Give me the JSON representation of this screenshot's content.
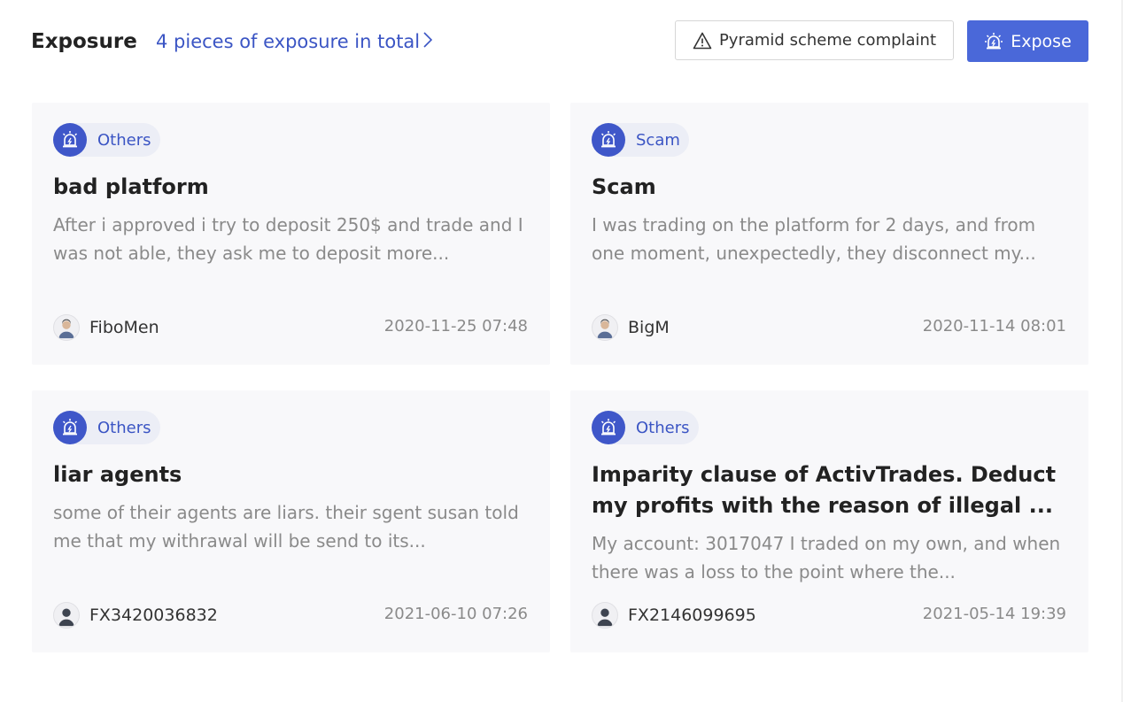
{
  "header": {
    "title": "Exposure",
    "total_link": "4 pieces of exposure in total",
    "complaint_button": "Pyramid scheme complaint",
    "expose_button": "Expose"
  },
  "colors": {
    "accent": "#4a68d9",
    "link": "#3b55c4",
    "card_bg": "#f8f8fa"
  },
  "cards": [
    {
      "tag": "Others",
      "title": "bad platform",
      "description": "After i approved i try to deposit 250$ and trade and I was not able, they ask me to deposit more...",
      "author": "FiboMen",
      "date": "2020-11-25 07:48"
    },
    {
      "tag": "Scam",
      "title": "Scam",
      "description": "I was trading on the platform for 2 days, and from one moment, unexpectedly, they disconnect my...",
      "author": "BigM",
      "date": "2020-11-14 08:01"
    },
    {
      "tag": "Others",
      "title": "liar agents",
      "description": "some of their agents are liars. their sgent susan told me that my withrawal will be send to its...",
      "author": "FX3420036832",
      "date": "2021-06-10 07:26"
    },
    {
      "tag": "Others",
      "title": "Imparity clause of  ActivTrades. Deduct my profits with the reason of illegal ...",
      "description": "My account: 3017047 I traded on my own, and when there was a loss to the point where the...",
      "author": "FX2146099695",
      "date": "2021-05-14 19:39"
    }
  ]
}
